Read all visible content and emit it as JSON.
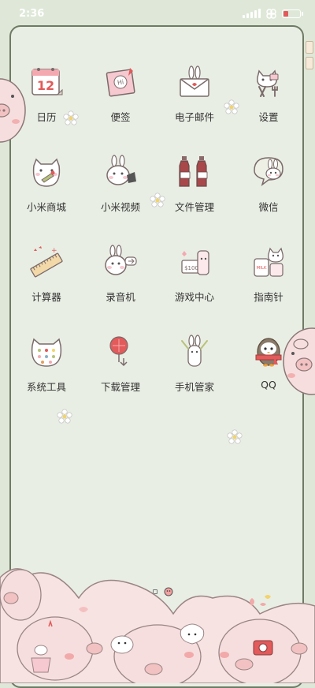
{
  "status_bar": {
    "time": "2:36"
  },
  "apps": [
    {
      "label": "日历",
      "icon": "calendar-icon",
      "day": "12",
      "name": "calendar"
    },
    {
      "label": "便签",
      "icon": "sticky-note-icon",
      "note": "Hi",
      "name": "notes"
    },
    {
      "label": "电子邮件",
      "icon": "envelope-icon",
      "name": "email"
    },
    {
      "label": "设置",
      "icon": "settings-icon",
      "name": "settings"
    },
    {
      "label": "小米商城",
      "icon": "shop-icon",
      "name": "mi-store"
    },
    {
      "label": "小米视频",
      "icon": "video-icon",
      "name": "mi-video"
    },
    {
      "label": "文件管理",
      "icon": "file-manager-icon",
      "name": "file-manager"
    },
    {
      "label": "微信",
      "icon": "wechat-icon",
      "name": "wechat"
    },
    {
      "label": "计算器",
      "icon": "calculator-icon",
      "name": "calculator"
    },
    {
      "label": "录音机",
      "icon": "recorder-icon",
      "name": "recorder"
    },
    {
      "label": "游戏中心",
      "icon": "game-center-icon",
      "coupon": "100",
      "name": "game-center"
    },
    {
      "label": "指南针",
      "icon": "compass-icon",
      "jar_label": "MILK",
      "name": "compass"
    },
    {
      "label": "系统工具",
      "icon": "system-tools-icon",
      "name": "system-tools"
    },
    {
      "label": "下载管理",
      "icon": "download-icon",
      "name": "download-manager"
    },
    {
      "label": "手机管家",
      "icon": "security-icon",
      "name": "security"
    },
    {
      "label": "QQ",
      "icon": "qq-icon",
      "name": "qq"
    }
  ],
  "page_indicator": {
    "pages": 3,
    "current": 1
  },
  "colors": {
    "background": "#dfe8d8",
    "frame": "#6e7a63",
    "pig": "#f6dede",
    "accent_red": "#e25a5a"
  }
}
